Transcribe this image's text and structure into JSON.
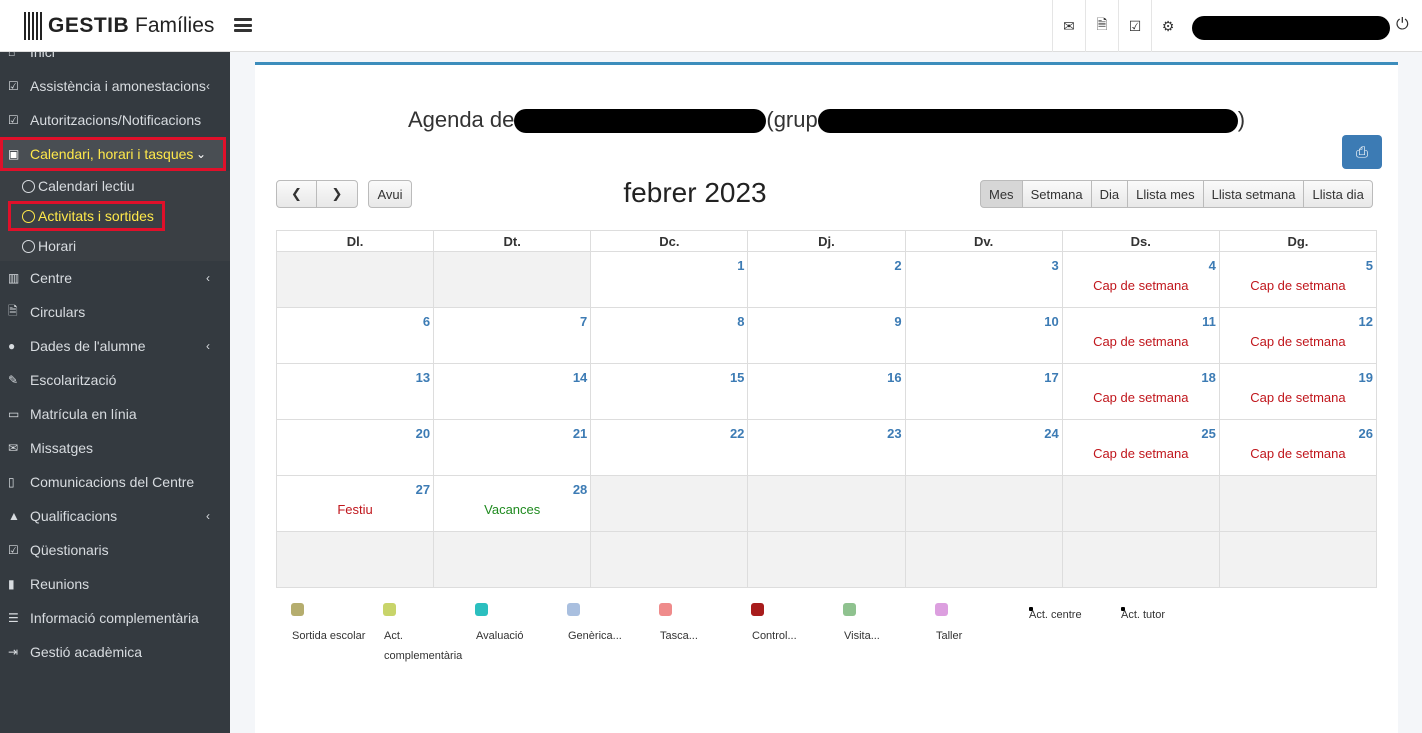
{
  "brand": {
    "bold": "GESTIB",
    "rest": " Famílies"
  },
  "topbar": {
    "icons": [
      "envelope-icon",
      "document-icon",
      "checkbox-icon",
      "gears-icon"
    ]
  },
  "sidebar": {
    "items": [
      {
        "label": "Inici",
        "icon": "home-icon"
      },
      {
        "label": "Assistència i amonestacions",
        "icon": "checkbox-icon",
        "chevron": "left"
      },
      {
        "label": "Autoritzacions/Notificacions",
        "icon": "checkbox-icon"
      },
      {
        "label": "Calendari, horari i tasques",
        "icon": "calendar-icon",
        "chevron": "down",
        "active": true
      },
      {
        "label": "Centre",
        "icon": "building-icon",
        "chevron": "left"
      },
      {
        "label": "Circulars",
        "icon": "document-icon"
      },
      {
        "label": "Dades de l'alumne",
        "icon": "user-icon",
        "chevron": "left"
      },
      {
        "label": "Escolarització",
        "icon": "edit-icon"
      },
      {
        "label": "Matrícula en línia",
        "icon": "laptop-icon"
      },
      {
        "label": "Missatges",
        "icon": "envelope-icon"
      },
      {
        "label": "Comunicacions del Centre",
        "icon": "mobile-icon"
      },
      {
        "label": "Qualificacions",
        "icon": "graduation-icon",
        "chevron": "left"
      },
      {
        "label": "Qüestionaris",
        "icon": "checkbox-icon"
      },
      {
        "label": "Reunions",
        "icon": "file-icon"
      },
      {
        "label": "Informació complementària",
        "icon": "list-icon"
      },
      {
        "label": "Gestió acadèmica",
        "icon": "login-icon"
      }
    ],
    "subitems": [
      "Calendari lectiu",
      "Activitats i sortides",
      "Horari"
    ]
  },
  "agenda": {
    "prefix": "Agenda de",
    "group_prefix": "(grup",
    "suffix": ")"
  },
  "calendar": {
    "title": "febrer 2023",
    "today_label": "Avui",
    "views": [
      "Mes",
      "Setmana",
      "Dia",
      "Llista mes",
      "Llista setmana",
      "Llista dia"
    ],
    "weekdays": [
      "Dl.",
      "Dt.",
      "Dc.",
      "Dj.",
      "Dv.",
      "Ds.",
      "Dg."
    ],
    "weeks": [
      [
        {
          "d": ""
        },
        {
          "d": ""
        },
        {
          "d": "1"
        },
        {
          "d": "2"
        },
        {
          "d": "3"
        },
        {
          "d": "4",
          "ev": "Cap de setmana",
          "c": "red"
        },
        {
          "d": "5",
          "ev": "Cap de setmana",
          "c": "red"
        }
      ],
      [
        {
          "d": "6"
        },
        {
          "d": "7"
        },
        {
          "d": "8"
        },
        {
          "d": "9"
        },
        {
          "d": "10"
        },
        {
          "d": "11",
          "ev": "Cap de setmana",
          "c": "red"
        },
        {
          "d": "12",
          "ev": "Cap de setmana",
          "c": "red"
        }
      ],
      [
        {
          "d": "13"
        },
        {
          "d": "14"
        },
        {
          "d": "15"
        },
        {
          "d": "16"
        },
        {
          "d": "17"
        },
        {
          "d": "18",
          "ev": "Cap de setmana",
          "c": "red"
        },
        {
          "d": "19",
          "ev": "Cap de setmana",
          "c": "red"
        }
      ],
      [
        {
          "d": "20"
        },
        {
          "d": "21"
        },
        {
          "d": "22"
        },
        {
          "d": "23"
        },
        {
          "d": "24"
        },
        {
          "d": "25",
          "ev": "Cap de setmana",
          "c": "red"
        },
        {
          "d": "26",
          "ev": "Cap de setmana",
          "c": "red"
        }
      ],
      [
        {
          "d": "27",
          "ev": "Festiu",
          "c": "red"
        },
        {
          "d": "28",
          "ev": "Vacances",
          "c": "green"
        },
        {
          "d": ""
        },
        {
          "d": ""
        },
        {
          "d": ""
        },
        {
          "d": ""
        },
        {
          "d": ""
        }
      ],
      [
        {
          "d": ""
        },
        {
          "d": ""
        },
        {
          "d": ""
        },
        {
          "d": ""
        },
        {
          "d": ""
        },
        {
          "d": ""
        },
        {
          "d": ""
        }
      ]
    ]
  },
  "legend": [
    {
      "label": "Sortida escolar",
      "color": "#b5ad6e"
    },
    {
      "label": "Act. complementària",
      "color": "#c8d46a"
    },
    {
      "label": "Avaluació",
      "color": "#2bbfbf"
    },
    {
      "label": "Genèrica...",
      "color": "#a9bfdf"
    },
    {
      "label": "Tasca...",
      "color": "#ef8b8b"
    },
    {
      "label": "Control...",
      "color": "#a81c1c"
    },
    {
      "label": "Visita...",
      "color": "#8fc28f"
    },
    {
      "label": "Taller",
      "color": "#dc9fdf"
    },
    {
      "label": "Act. centre",
      "color": "#000000",
      "dot": true
    },
    {
      "label": "Act. tutor",
      "color": "#000000",
      "dot": true
    }
  ]
}
